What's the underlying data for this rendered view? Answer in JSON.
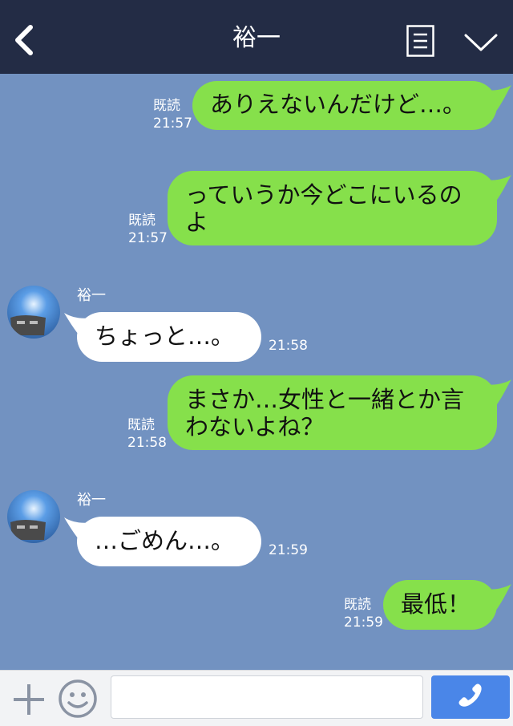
{
  "header": {
    "title": "裕一",
    "back_icon": "chevron-left-icon",
    "menu_icon": "list-menu-icon",
    "collapse_icon": "chevron-down-icon"
  },
  "messages": [
    {
      "from": "me",
      "text_lines": [
        "ありえないんだけど…。"
      ],
      "read": "既読",
      "time": "21:57"
    },
    {
      "from": "me",
      "text_lines": [
        "っていうか今どこにいるの",
        "よ"
      ],
      "read": "既読",
      "time": "21:57"
    },
    {
      "from": "them",
      "sender": "裕一",
      "text_lines": [
        "ちょっと…。"
      ],
      "time": "21:58"
    },
    {
      "from": "me",
      "text_lines": [
        "まさか…女性と一緒とか言",
        "わないよね？"
      ],
      "read": "既読",
      "time": "21:58"
    },
    {
      "from": "them",
      "sender": "裕一",
      "text_lines": [
        "…ごめん…。"
      ],
      "time": "21:59"
    },
    {
      "from": "me",
      "text_lines": [
        "最低！"
      ],
      "read": "既読",
      "time": "21:59"
    }
  ],
  "input_bar": {
    "plus_icon": "plus-icon",
    "emoji_icon": "smiley-icon",
    "input_value": "",
    "call_icon": "phone-icon"
  },
  "colors": {
    "header_bg": "#232c45",
    "chat_bg": "#7292c1",
    "my_bubble": "#86e04b",
    "their_bubble": "#ffffff",
    "call_button": "#4a86e8"
  }
}
